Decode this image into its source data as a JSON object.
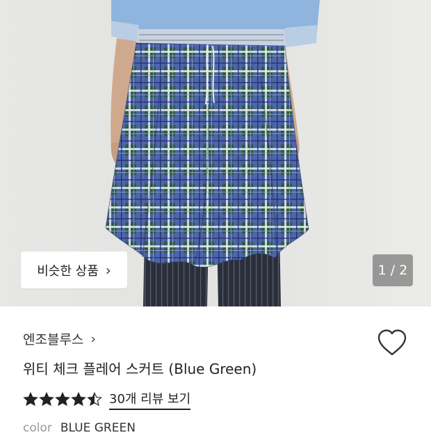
{
  "gallery": {
    "similar_button_label": "비슷한 상품",
    "similar_button_chevron": "›",
    "counter_text": "1 / 2"
  },
  "product": {
    "brand": "엔조블루스",
    "brand_chevron": "›",
    "title": "위티 체크 플레어 스커트 (Blue Green)",
    "rating": 4.5,
    "review_link": "30개 리뷰 보기",
    "color_label": "color",
    "color_value": "BLUE GREEN",
    "favorite_icon": "heart-outline-icon"
  },
  "colors": {
    "background": "#ffffff",
    "photo_wall": "#e4e4e2",
    "sweater": "#8fb4dd",
    "skirt_blue": "#4a5fa6",
    "skirt_green": "#2f5b46",
    "pants": "#2b2f3a",
    "star": "#222222"
  }
}
